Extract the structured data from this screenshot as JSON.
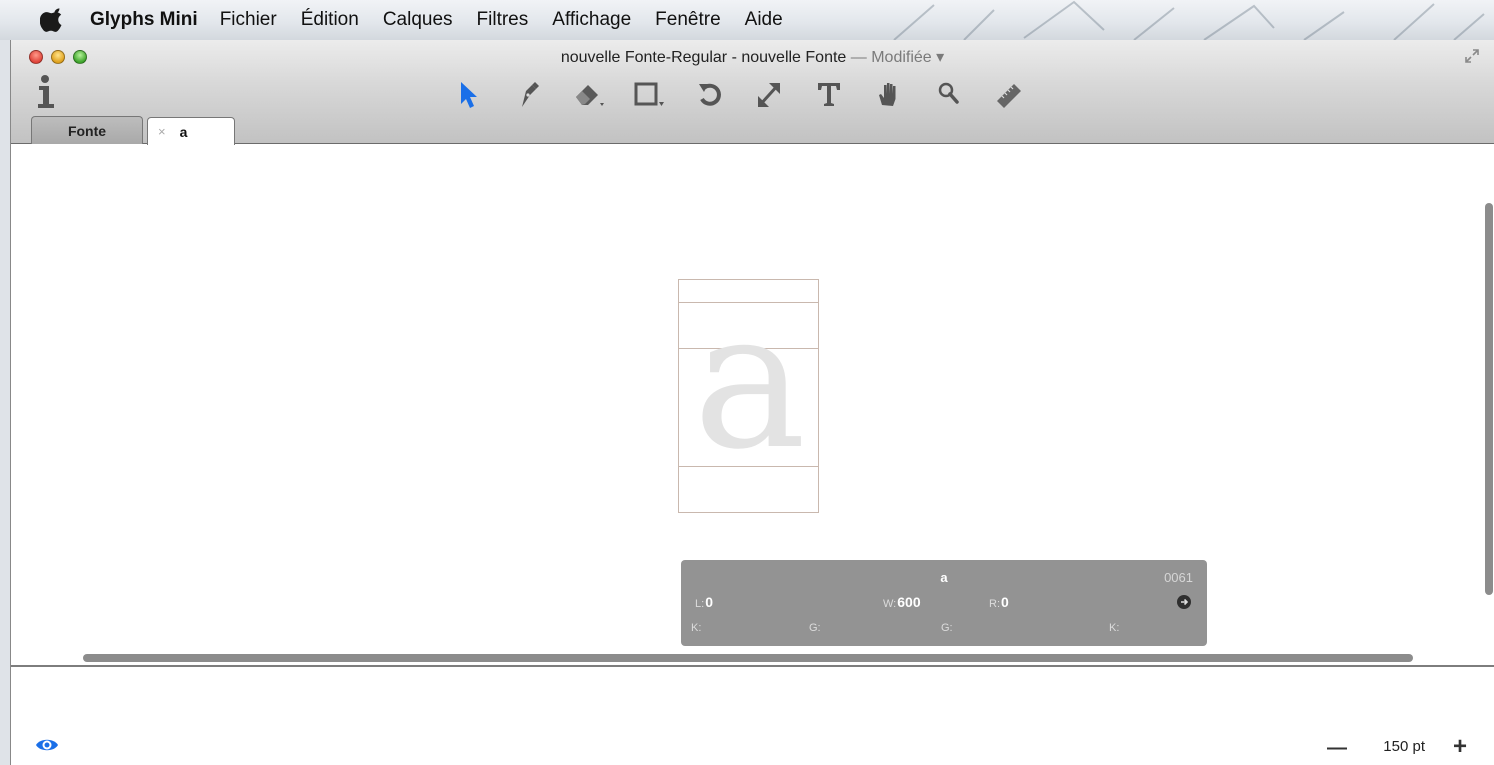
{
  "menubar": {
    "app_name": "Glyphs Mini",
    "items": [
      "Fichier",
      "Édition",
      "Calques",
      "Filtres",
      "Affichage",
      "Fenêtre",
      "Aide"
    ]
  },
  "window": {
    "title": "nouvelle Fonte-Regular - nouvelle Fonte",
    "modified": "— Modifiée ▾"
  },
  "toolbar": {
    "tools": [
      "select-tool",
      "pen-tool",
      "eraser-tool",
      "rectangle-tool",
      "rotate-tool",
      "scale-tool",
      "text-tool",
      "hand-tool",
      "zoom-tool",
      "measure-tool"
    ],
    "active": "select-tool",
    "accent": "#1a6fe8"
  },
  "tabs": {
    "fonte": "Fonte",
    "glyph_close": "×",
    "glyph": "a"
  },
  "canvas": {
    "glyph_char": "a"
  },
  "glyph_panel": {
    "name": "a",
    "code": "0061",
    "left_label": "L:",
    "left_value": "0",
    "width_label": "W:",
    "width_value": "600",
    "right_label": "R:",
    "right_value": "0",
    "k1": "K:",
    "g1": "G:",
    "g2": "G:",
    "k2": "K:"
  },
  "footer": {
    "zoom_minus": "—",
    "zoom": "150 pt",
    "zoom_plus": "+"
  }
}
